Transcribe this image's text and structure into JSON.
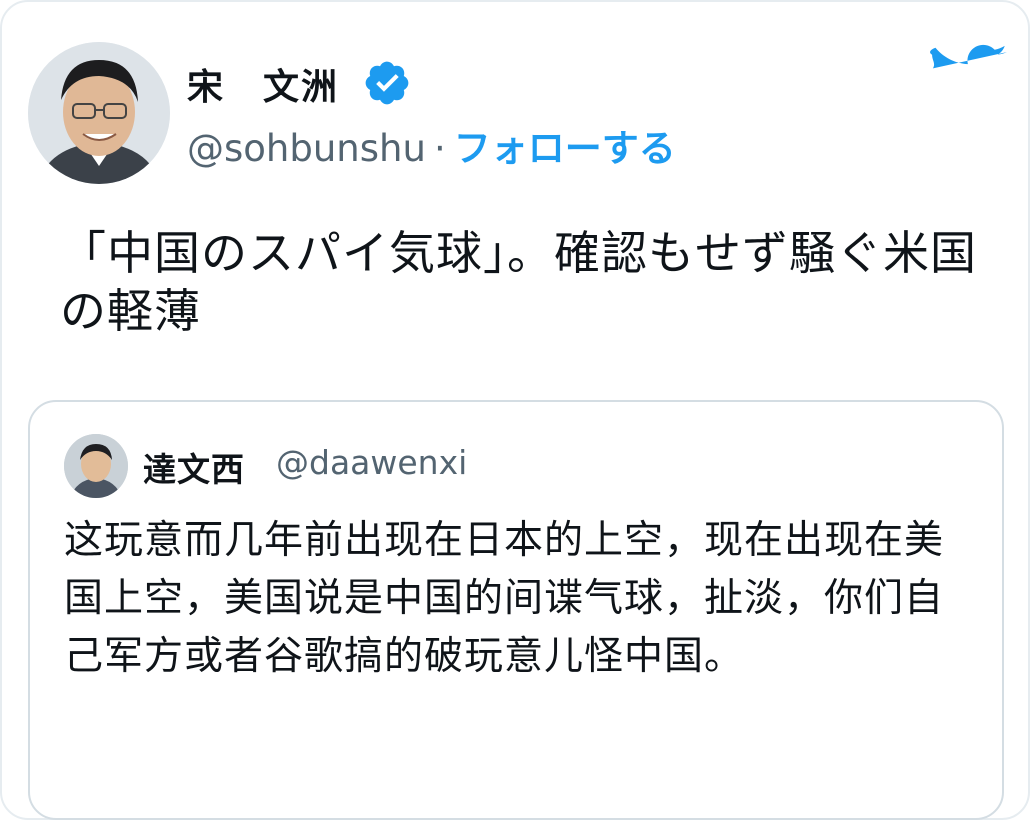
{
  "tweet": {
    "author_name": "宋　文洲",
    "handle": "@sohbunshu",
    "separator": "·",
    "follow_label": "フォローする",
    "text": "「中国のスパイ気球」。確認もせず騒ぐ米国の軽薄"
  },
  "quoted_tweet": {
    "author_name": "達文西",
    "handle": "@daawenxi",
    "text": "这玩意而几年前出现在日本的上空，现在出现在美国上空，美国说是中国的间谍气球，扯淡，你们自己军方或者谷歌搞的破玩意儿怪中国。"
  },
  "icons": {
    "verified": "verified-badge-icon",
    "brand": "twitter-bird-icon"
  },
  "colors": {
    "accent": "#1d9bf0",
    "secondary_text": "#536471",
    "border": "#d4dde3"
  }
}
